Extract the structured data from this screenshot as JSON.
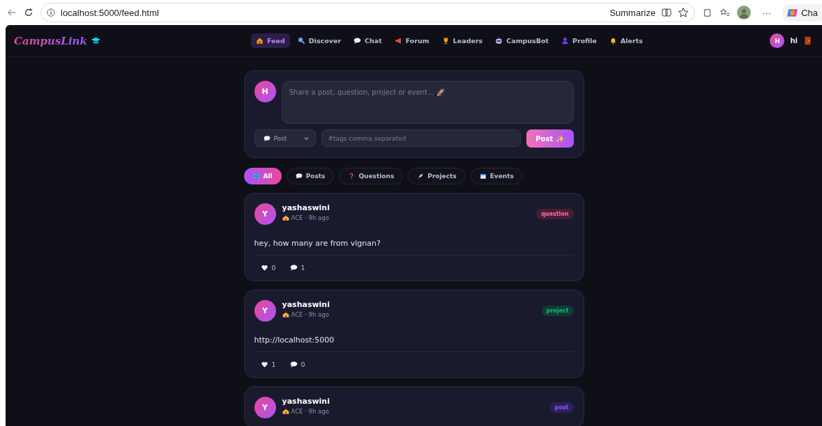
{
  "browser": {
    "url": "localhost:5000/feed.html",
    "summarize": "Summarize",
    "more": "···",
    "copilot": "Cha"
  },
  "navbar": {
    "logo": "CampusLink",
    "items": [
      {
        "label": "Feed",
        "selected": true
      },
      {
        "label": "Discover",
        "selected": false
      },
      {
        "label": "Chat",
        "selected": false
      },
      {
        "label": "Forum",
        "selected": false
      },
      {
        "label": "Leaders",
        "selected": false
      },
      {
        "label": "CampusBot",
        "selected": false
      },
      {
        "label": "Profile",
        "selected": false
      },
      {
        "label": "Alerts",
        "selected": false
      }
    ],
    "user": {
      "initial": "H",
      "name": "hi"
    }
  },
  "composer": {
    "avatar": "H",
    "placeholder": "Share a post, question, project or event... 🚀",
    "type": "Post",
    "tags_placeholder": "#tags comma separated",
    "submit": "Post ✨"
  },
  "filters": [
    {
      "label": "All",
      "selected": true
    },
    {
      "label": "Posts",
      "selected": false
    },
    {
      "label": "Questions",
      "selected": false
    },
    {
      "label": "Projects",
      "selected": false
    },
    {
      "label": "Events",
      "selected": false
    }
  ],
  "posts": [
    {
      "avatar": "Y",
      "author": "yashaswini",
      "meta": "ACE · 9h ago",
      "tag": "question",
      "kind": "question",
      "text": "hey, how many are from vignan?",
      "likes": "0",
      "comments": "1"
    },
    {
      "avatar": "Y",
      "author": "yashaswini",
      "meta": "ACE · 9h ago",
      "tag": "project",
      "kind": "project",
      "text": "http://localhost:5000",
      "likes": "1",
      "comments": "0"
    },
    {
      "avatar": "Y",
      "author": "yashaswini",
      "meta": "ACE · 9h ago",
      "tag": "post",
      "kind": "post"
    }
  ]
}
